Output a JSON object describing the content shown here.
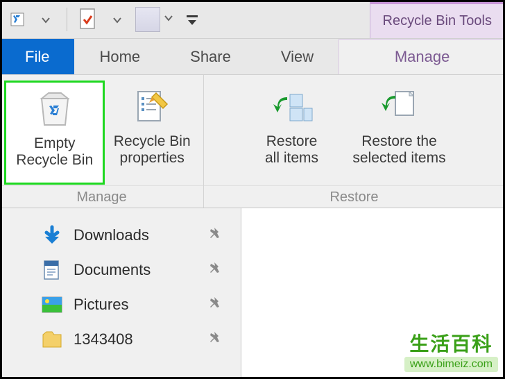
{
  "qat": {
    "tools_label": "Recycle Bin Tools"
  },
  "tabs": {
    "file": "File",
    "home": "Home",
    "share": "Share",
    "view": "View",
    "manage": "Manage"
  },
  "ribbon": {
    "groups": {
      "manage": {
        "label": "Manage",
        "empty": "Empty\nRecycle Bin",
        "properties": "Recycle Bin\nproperties"
      },
      "restore": {
        "label": "Restore",
        "restore_all": "Restore\nall items",
        "restore_selected": "Restore the\nselected items"
      }
    }
  },
  "nav": {
    "items": [
      {
        "icon": "download",
        "label": "Downloads"
      },
      {
        "icon": "document",
        "label": "Documents"
      },
      {
        "icon": "pictures",
        "label": "Pictures"
      },
      {
        "icon": "folder",
        "label": "1343408"
      }
    ]
  },
  "watermark": {
    "title": "生活百科",
    "url": "www.bimeiz.com"
  }
}
